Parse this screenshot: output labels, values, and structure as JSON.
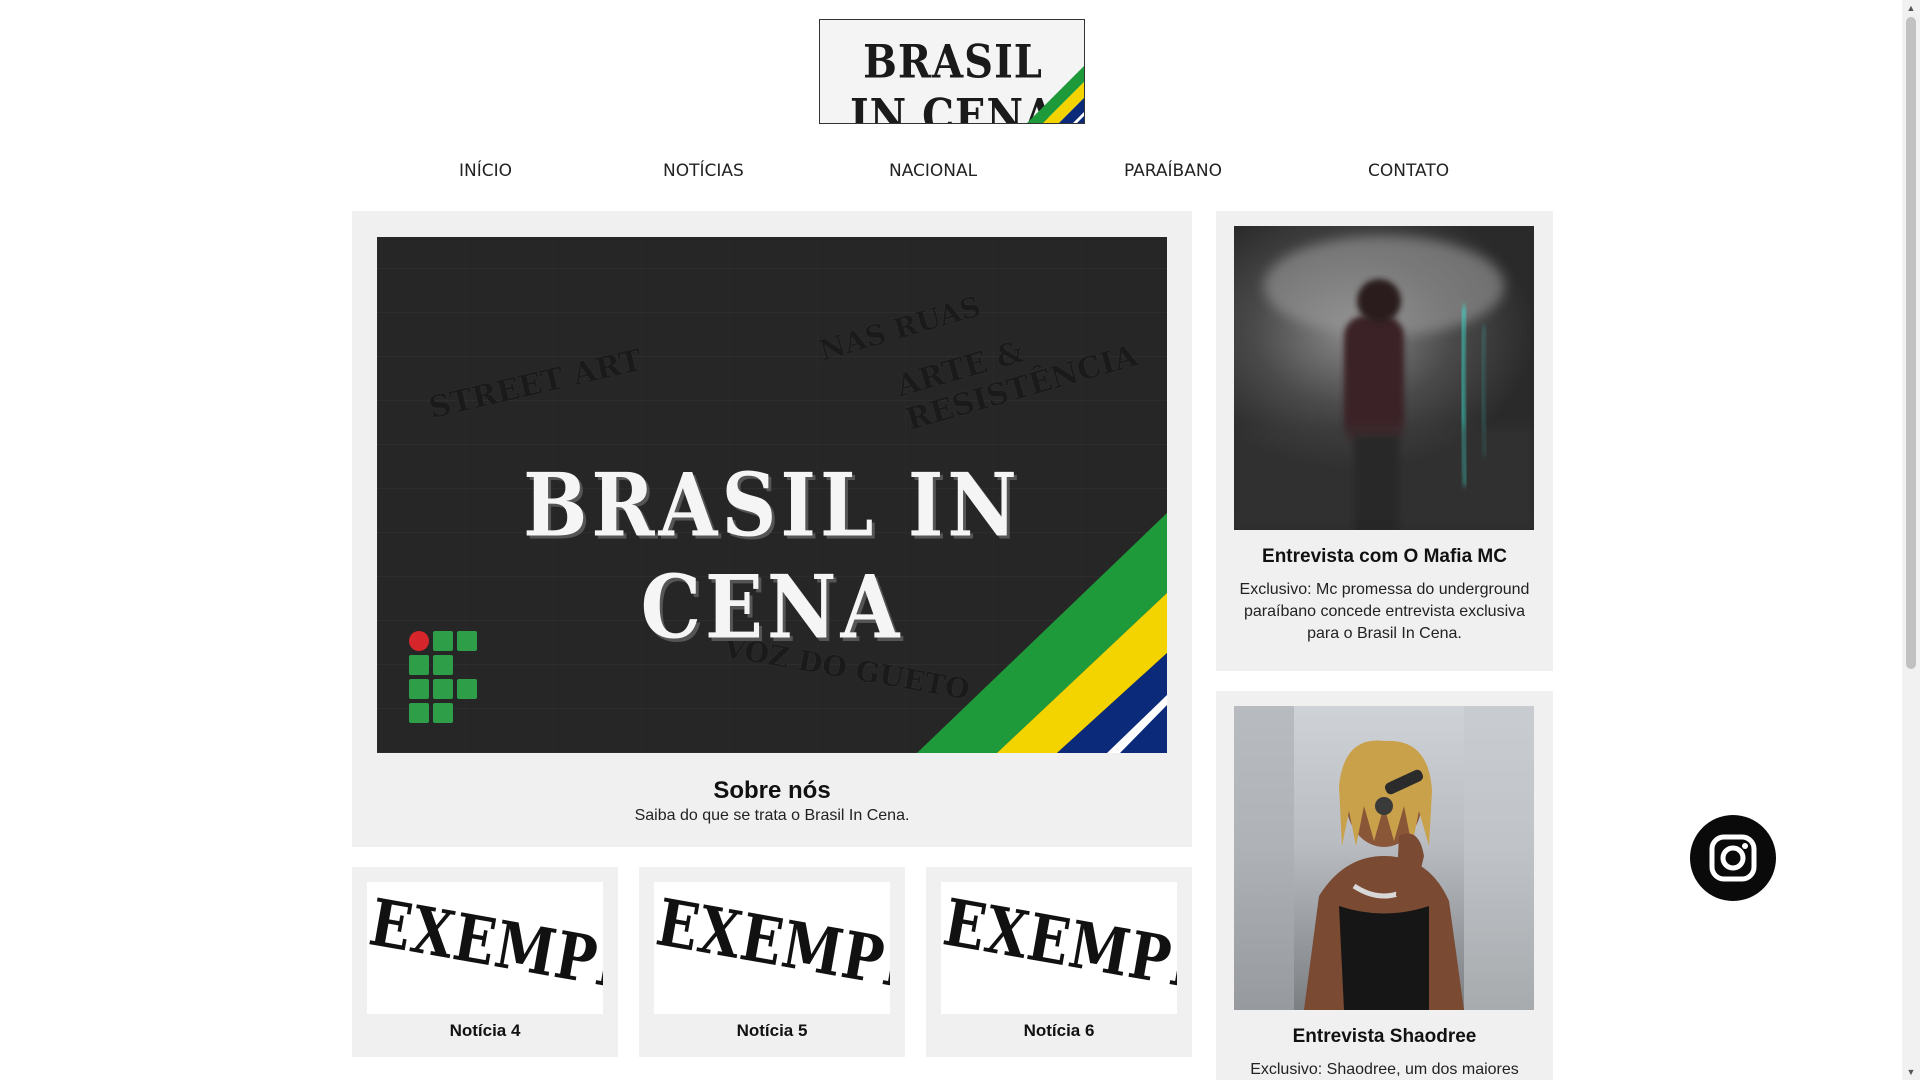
{
  "brand": {
    "logo_text": "BRASIL IN CENA"
  },
  "nav": {
    "items": [
      {
        "label": "INÍCIO"
      },
      {
        "label": "NOTÍCIAS"
      },
      {
        "label": "NACIONAL"
      },
      {
        "label": "PARAÍBANO"
      },
      {
        "label": "CONTATO"
      }
    ]
  },
  "feature": {
    "banner_title": "BRASIL IN CENA",
    "banner_tags": [
      "STREET ART",
      "NAS RUAS",
      "ARTE & RESISTÊNCIA",
      "VOZ DO GUETO"
    ],
    "title": "Sobre nós",
    "subtitle": "Saiba do que se trata o Brasil In Cena."
  },
  "news": [
    {
      "thumb_text": "EXEMPLO",
      "title": "Notícia 4"
    },
    {
      "thumb_text": "EXEMPLO",
      "title": "Notícia 5"
    },
    {
      "thumb_text": "EXEMPLO",
      "title": "Notícia 6"
    }
  ],
  "side": [
    {
      "title": "Entrevista com O Mafia MC",
      "text": "Exclusivo: Mc promessa do underground paraíbano concede entrevista exclusiva para o Brasil In Cena."
    },
    {
      "title": "Entrevista Shaodree",
      "text": "Exclusivo: Shaodree, um dos maiores"
    }
  ],
  "social": {
    "icon": "instagram-icon"
  },
  "colors": {
    "card_bg": "#f0f0f0",
    "flag_green": "#1f9a3a",
    "flag_yellow": "#f4d400",
    "flag_blue": "#0b2a7a",
    "ifpb_green": "#2e9e48",
    "ifpb_red": "#d6262c"
  }
}
